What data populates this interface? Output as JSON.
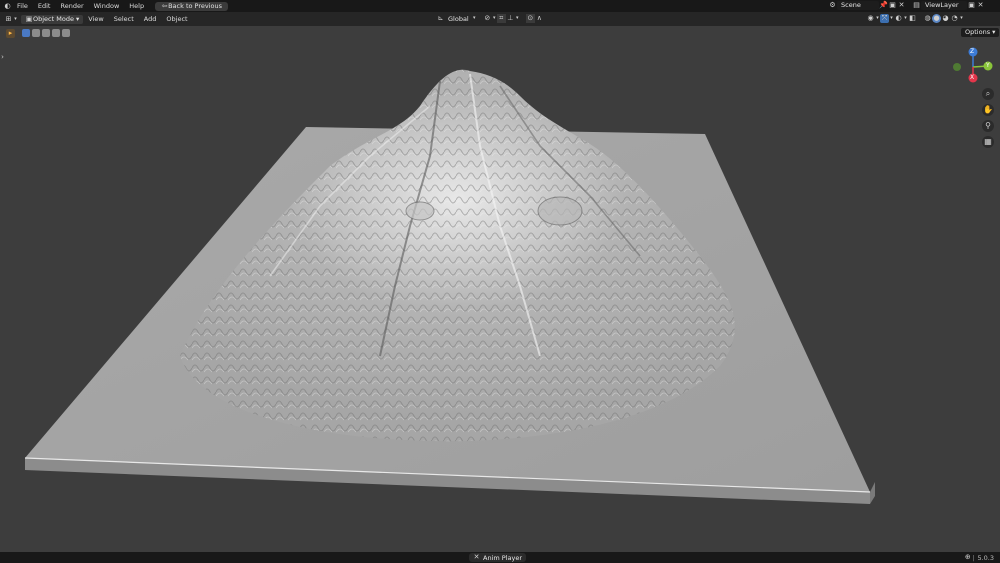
{
  "topbar": {
    "menus": [
      "File",
      "Edit",
      "Render",
      "Window",
      "Help"
    ],
    "back_button": "Back to Previous",
    "scene_label": "Scene",
    "viewlayer_label": "ViewLayer"
  },
  "header": {
    "mode": "Object Mode",
    "menus": [
      "View",
      "Select",
      "Add",
      "Object"
    ],
    "transform_orientation": "Global",
    "options_label": "Options"
  },
  "gizmo": {
    "axes": [
      "Z",
      "Y",
      "X"
    ],
    "axis_colors": {
      "x": "#e3364b",
      "y": "#8ac53a",
      "z": "#3c7cd8"
    }
  },
  "statusbar": {
    "center_item": "Anim Player",
    "version": "5.0.3"
  },
  "icons": [
    "blender-logo-icon",
    "editor-type-icon",
    "object-mode-icon",
    "transform-orientation-icon",
    "snap-icon",
    "proportional-edit-icon",
    "visibility-icon",
    "gizmo-icon",
    "overlay-icon",
    "xray-icon",
    "wireframe-shading-icon",
    "solid-shading-icon",
    "material-shading-icon",
    "rendered-shading-icon",
    "zoom-icon",
    "hand-pan-icon",
    "camera-icon",
    "grid-icon",
    "globe-icon"
  ]
}
